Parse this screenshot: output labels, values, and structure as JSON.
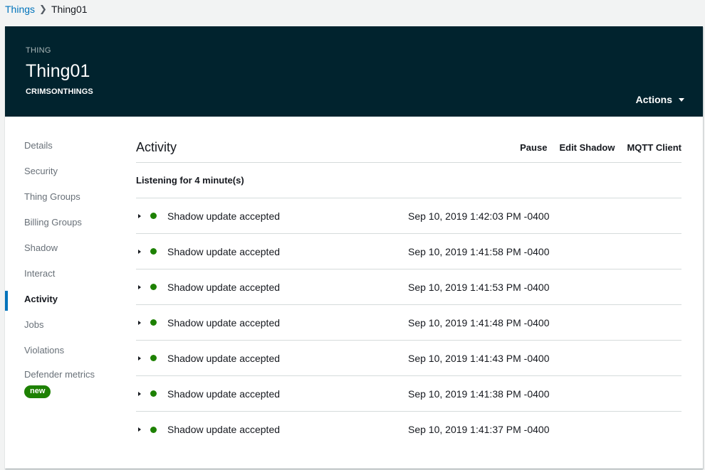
{
  "breadcrumb": {
    "parent": "Things",
    "current": "Thing01"
  },
  "header": {
    "type_label": "THING",
    "title": "Thing01",
    "subtitle": "CRIMSONTHINGS",
    "actions_label": "Actions"
  },
  "sidenav": {
    "items": [
      {
        "label": "Details"
      },
      {
        "label": "Security"
      },
      {
        "label": "Thing Groups"
      },
      {
        "label": "Billing Groups"
      },
      {
        "label": "Shadow"
      },
      {
        "label": "Interact"
      },
      {
        "label": "Activity",
        "active": true
      },
      {
        "label": "Jobs"
      },
      {
        "label": "Violations"
      },
      {
        "label": "Defender metrics",
        "badge": "new"
      }
    ]
  },
  "main": {
    "title": "Activity",
    "tools": {
      "pause": "Pause",
      "edit_shadow": "Edit Shadow",
      "mqtt_client": "MQTT Client"
    },
    "status": "Listening for 4 minute(s)",
    "events": [
      {
        "message": "Shadow update accepted",
        "timestamp": "Sep 10, 2019 1:42:03 PM -0400"
      },
      {
        "message": "Shadow update accepted",
        "timestamp": "Sep 10, 2019 1:41:58 PM -0400"
      },
      {
        "message": "Shadow update accepted",
        "timestamp": "Sep 10, 2019 1:41:53 PM -0400"
      },
      {
        "message": "Shadow update accepted",
        "timestamp": "Sep 10, 2019 1:41:48 PM -0400"
      },
      {
        "message": "Shadow update accepted",
        "timestamp": "Sep 10, 2019 1:41:43 PM -0400"
      },
      {
        "message": "Shadow update accepted",
        "timestamp": "Sep 10, 2019 1:41:38 PM -0400"
      },
      {
        "message": "Shadow update accepted",
        "timestamp": "Sep 10, 2019 1:41:37 PM -0400"
      }
    ]
  },
  "colors": {
    "header_bg": "#01232e",
    "link": "#0073bb",
    "status_success": "#1d8102",
    "active_indicator": "#0073bb"
  },
  "icons": {
    "breadcrumb_separator": "chevron-right-icon",
    "actions_caret": "caret-down-icon",
    "row_expand": "caret-right-icon",
    "row_status": "status-dot-icon"
  }
}
